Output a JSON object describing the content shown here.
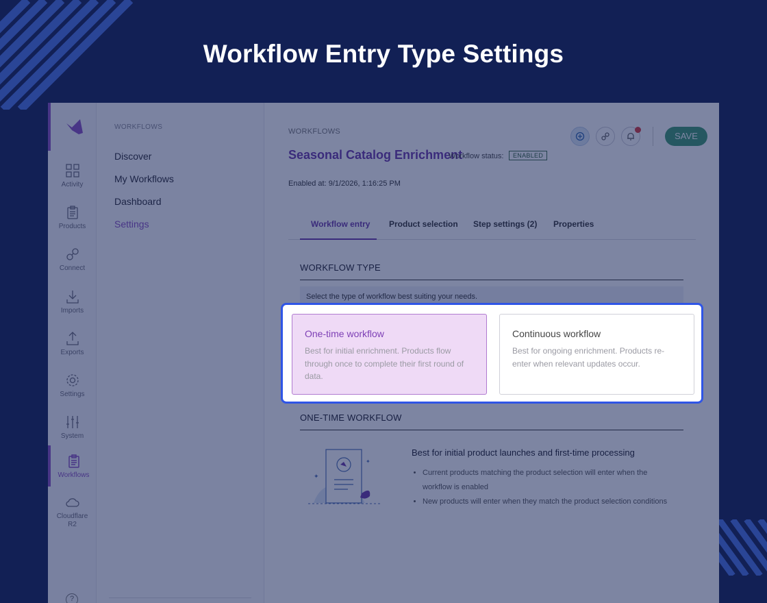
{
  "headline": "Workflow Entry Type Settings",
  "rail": {
    "items": [
      {
        "label": "Activity",
        "icon": "grid-icon"
      },
      {
        "label": "Products",
        "icon": "clipboard-icon"
      },
      {
        "label": "Connect",
        "icon": "link-icon"
      },
      {
        "label": "Imports",
        "icon": "download-icon"
      },
      {
        "label": "Exports",
        "icon": "upload-icon"
      },
      {
        "label": "Settings",
        "icon": "gear-icon"
      },
      {
        "label": "System",
        "icon": "sliders-icon"
      },
      {
        "label": "Workflows",
        "icon": "workflow-icon"
      },
      {
        "label": "Cloudflare R2",
        "icon": "cloud-icon"
      }
    ],
    "help_glyph": "?"
  },
  "nav": {
    "section": "WORKFLOWS",
    "items": [
      "Discover",
      "My Workflows",
      "Dashboard",
      "Settings"
    ],
    "active": "Settings"
  },
  "main": {
    "breadcrumb": "WORKFLOWS",
    "title": "Seasonal Catalog Enrichment",
    "status_label": "Workflow status:",
    "status_value": "ENABLED",
    "enabled_at": "Enabled at: 9/1/2026, 1:16:25 PM",
    "save_label": "SAVE",
    "tabs": [
      "Workflow entry",
      "Product selection",
      "Step settings (2)",
      "Properties"
    ],
    "active_tab": "Workflow entry",
    "workflow_type_heading": "WORKFLOW TYPE",
    "hint": "Select the type of workflow best suiting your needs.",
    "options": [
      {
        "title": "One-time workflow",
        "desc": "Best for initial enrichment. Products flow through once to complete their first round of data.",
        "selected": true
      },
      {
        "title": "Continuous workflow",
        "desc": "Best for ongoing enrichment. Products re-enter when relevant updates occur.",
        "selected": false
      }
    ],
    "onetime_heading": "ONE-TIME WORKFLOW",
    "onetime_subheading": "Best for initial product launches and first-time processing",
    "onetime_bullets": [
      "Current products matching the product selection will enter when the workflow is enabled",
      "New products will enter when they match the product selection conditions"
    ]
  },
  "colors": {
    "background": "#122055",
    "accent": "#8a4fc2",
    "save": "#3d9970",
    "highlight_border": "#2f55e6"
  }
}
